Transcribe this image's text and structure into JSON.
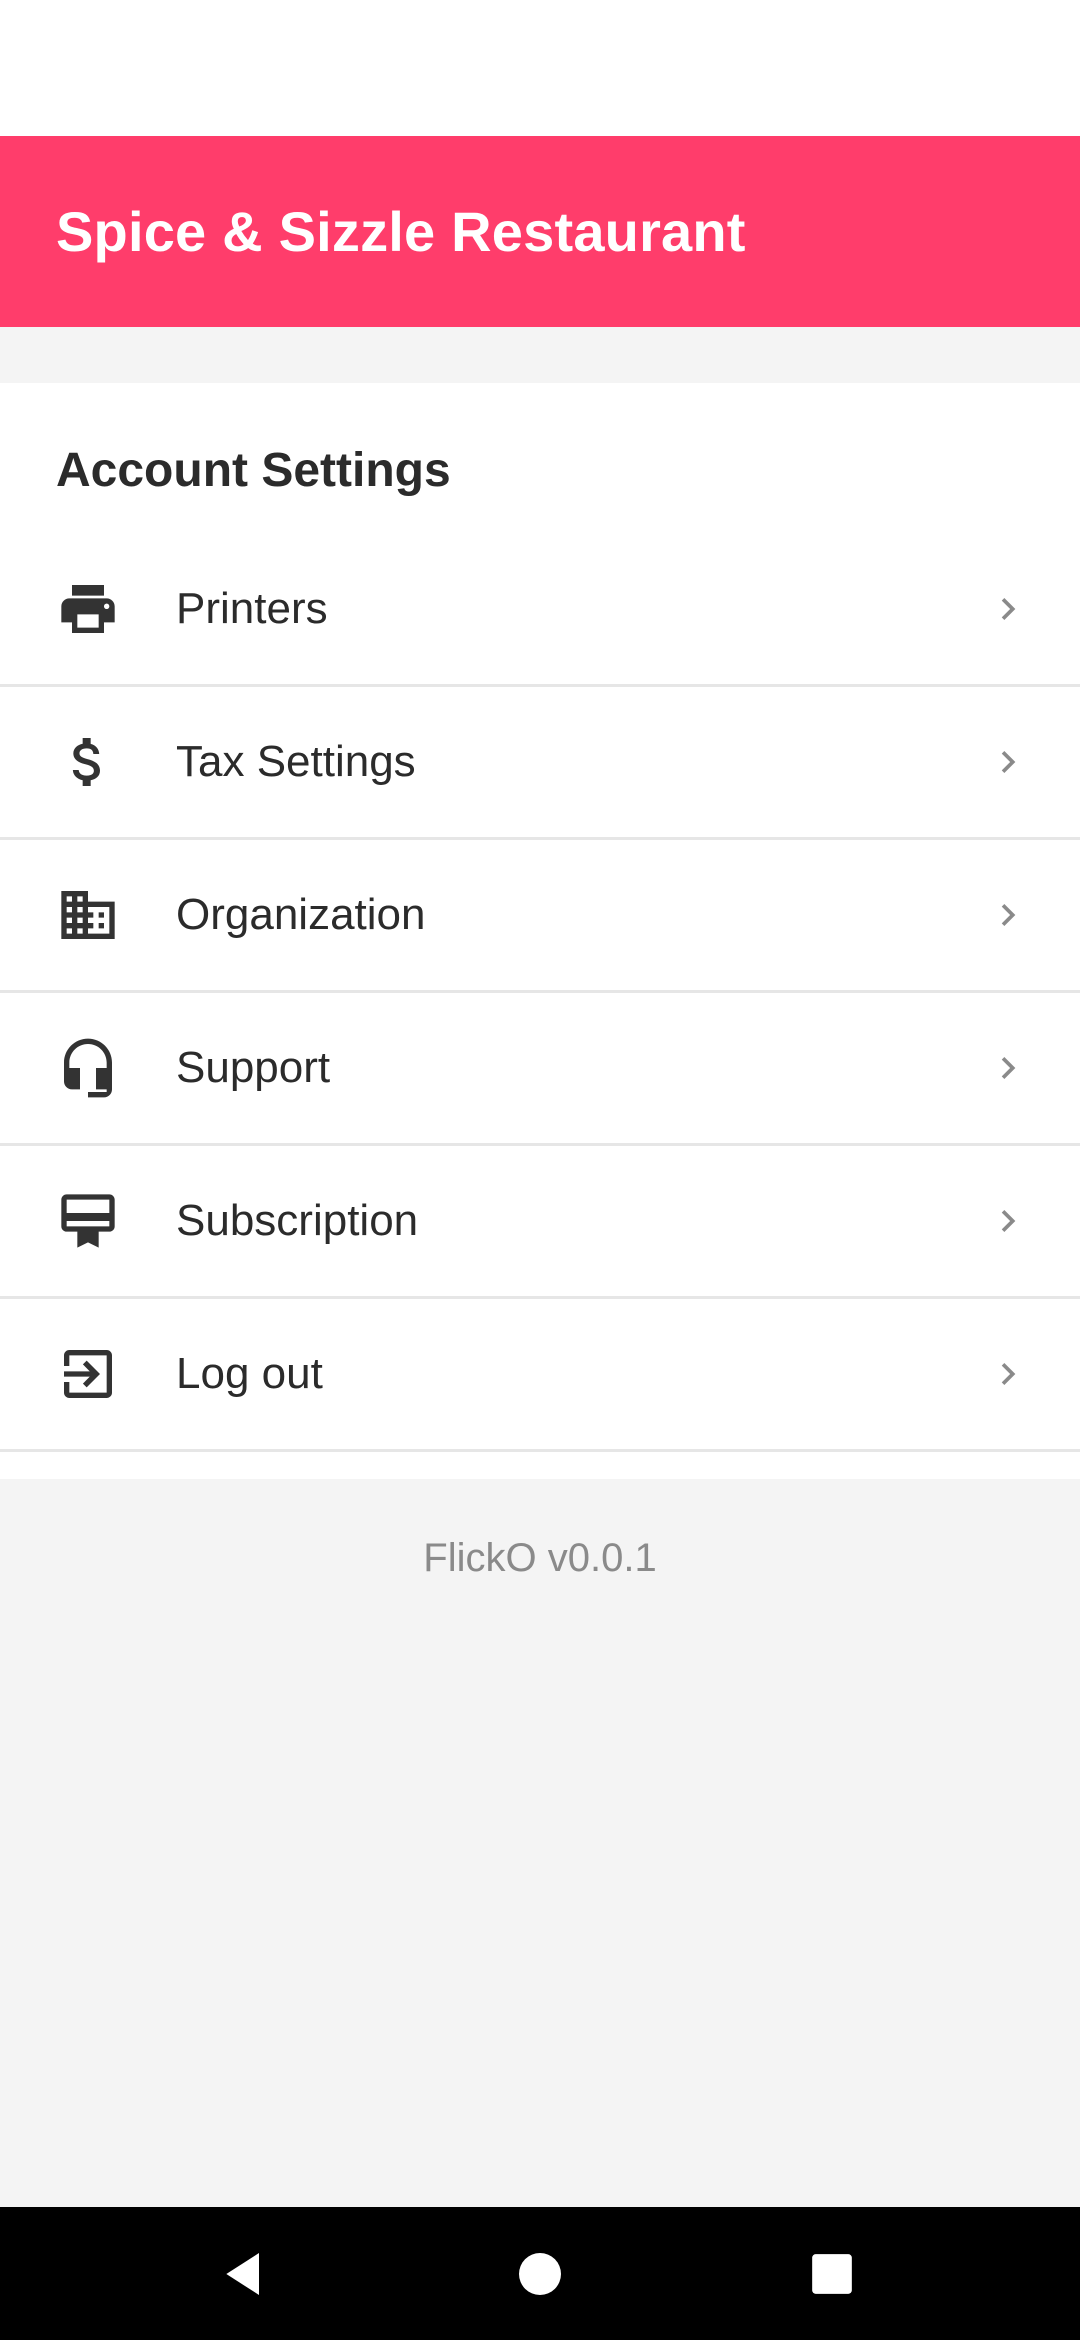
{
  "header": {
    "title": "Spice & Sizzle Restaurant",
    "background_color": "#ff3d6b"
  },
  "section": {
    "title": "Account Settings"
  },
  "settings": {
    "items": [
      {
        "label": "Printers",
        "icon": "printer-icon"
      },
      {
        "label": "Tax Settings",
        "icon": "dollar-icon"
      },
      {
        "label": "Organization",
        "icon": "building-icon"
      },
      {
        "label": "Support",
        "icon": "headset-icon"
      },
      {
        "label": "Subscription",
        "icon": "subscription-icon"
      },
      {
        "label": "Log out",
        "icon": "logout-icon"
      }
    ]
  },
  "footer": {
    "version": "FlickO v0.0.1"
  },
  "navigation": {
    "buttons": [
      "back-icon",
      "home-icon",
      "recents-icon"
    ]
  }
}
